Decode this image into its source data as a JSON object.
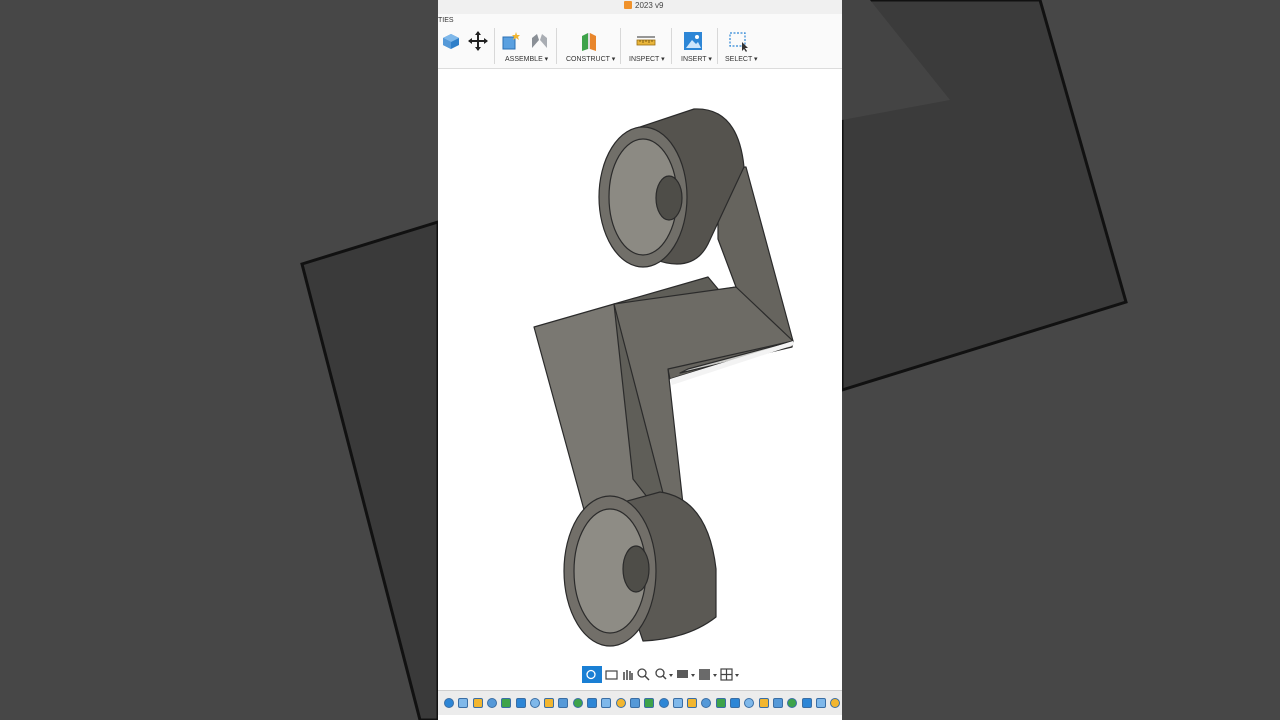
{
  "app": {
    "title": "2023 v9",
    "workspace_tab_fragment": "TIES"
  },
  "toolbar": {
    "groups": [
      {
        "label": "ASSEMBLE ▾",
        "icons": [
          "new-component-icon",
          "joint-icon"
        ]
      },
      {
        "label": "CONSTRUCT ▾",
        "icons": [
          "plane-icon"
        ]
      },
      {
        "label": "INSPECT ▾",
        "icons": [
          "measure-icon"
        ]
      },
      {
        "label": "INSERT ▾",
        "icons": [
          "image-icon"
        ]
      },
      {
        "label": "SELECT ▾",
        "icons": [
          "select-window-icon"
        ]
      }
    ],
    "modify_icons": [
      "press-pull-icon",
      "move-icon"
    ]
  },
  "navbar": {
    "tools": [
      "orbit-icon",
      "look-at-icon",
      "pan-icon",
      "zoom-icon",
      "fit-icon",
      "display-settings-icon",
      "grid-settings-icon",
      "viewports-icon"
    ]
  },
  "timeline": {
    "item_count": 28
  },
  "colors": {
    "background": "#474747",
    "part_face": "#6f6d66",
    "ribbon": "#fafafa",
    "accent": "#1a7fd4"
  }
}
